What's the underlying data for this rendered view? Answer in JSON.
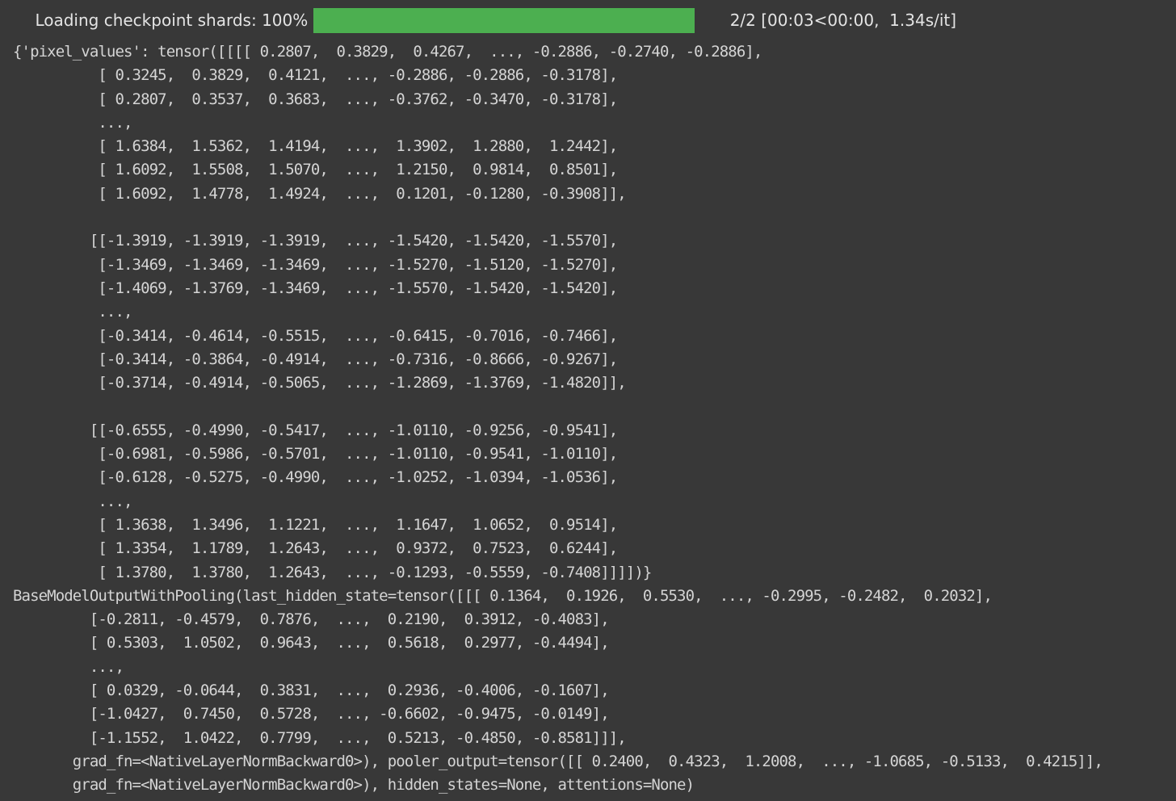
{
  "progress": {
    "description": "Loading checkpoint shards:",
    "percent_label": "100%",
    "fraction": 1.0,
    "count": "2/2",
    "timing": "[00:03<00:00,",
    "rate": "1.34s/it]",
    "fill_color": "#4caf50"
  },
  "output_lines": [
    "{'pixel_values': tensor([[[[ 0.2807,  0.3829,  0.4267,  ..., -0.2886, -0.2740, -0.2886],",
    "          [ 0.3245,  0.3829,  0.4121,  ..., -0.2886, -0.2886, -0.3178],",
    "          [ 0.2807,  0.3537,  0.3683,  ..., -0.3762, -0.3470, -0.3178],",
    "          ...,",
    "          [ 1.6384,  1.5362,  1.4194,  ...,  1.3902,  1.2880,  1.2442],",
    "          [ 1.6092,  1.5508,  1.5070,  ...,  1.2150,  0.9814,  0.8501],",
    "          [ 1.6092,  1.4778,  1.4924,  ...,  0.1201, -0.1280, -0.3908]],",
    "",
    "         [[-1.3919, -1.3919, -1.3919,  ..., -1.5420, -1.5420, -1.5570],",
    "          [-1.3469, -1.3469, -1.3469,  ..., -1.5270, -1.5120, -1.5270],",
    "          [-1.4069, -1.3769, -1.3469,  ..., -1.5570, -1.5420, -1.5420],",
    "          ...,",
    "          [-0.3414, -0.4614, -0.5515,  ..., -0.6415, -0.7016, -0.7466],",
    "          [-0.3414, -0.3864, -0.4914,  ..., -0.7316, -0.8666, -0.9267],",
    "          [-0.3714, -0.4914, -0.5065,  ..., -1.2869, -1.3769, -1.4820]],",
    "",
    "         [[-0.6555, -0.4990, -0.5417,  ..., -1.0110, -0.9256, -0.9541],",
    "          [-0.6981, -0.5986, -0.5701,  ..., -1.0110, -0.9541, -1.0110],",
    "          [-0.6128, -0.5275, -0.4990,  ..., -1.0252, -1.0394, -1.0536],",
    "          ...,",
    "          [ 1.3638,  1.3496,  1.1221,  ...,  1.1647,  1.0652,  0.9514],",
    "          [ 1.3354,  1.1789,  1.2643,  ...,  0.9372,  0.7523,  0.6244],",
    "          [ 1.3780,  1.3780,  1.2643,  ..., -0.1293, -0.5559, -0.7408]]]])}",
    "BaseModelOutputWithPooling(last_hidden_state=tensor([[[ 0.1364,  0.1926,  0.5530,  ..., -0.2995, -0.2482,  0.2032],",
    "         [-0.2811, -0.4579,  0.7876,  ...,  0.2190,  0.3912, -0.4083],",
    "         [ 0.5303,  1.0502,  0.9643,  ...,  0.5618,  0.2977, -0.4494],",
    "         ...,",
    "         [ 0.0329, -0.0644,  0.3831,  ...,  0.2936, -0.4006, -0.1607],",
    "         [-1.0427,  0.7450,  0.5728,  ..., -0.6602, -0.9475, -0.0149],",
    "         [-1.1552,  1.0422,  0.7799,  ...,  0.5213, -0.4850, -0.8581]]],",
    "       grad_fn=<NativeLayerNormBackward0>), pooler_output=tensor([[ 0.2400,  0.4323,  1.2008,  ..., -1.0685, -0.5133,  0.4215]],",
    "       grad_fn=<NativeLayerNormBackward0>), hidden_states=None, attentions=None)"
  ]
}
